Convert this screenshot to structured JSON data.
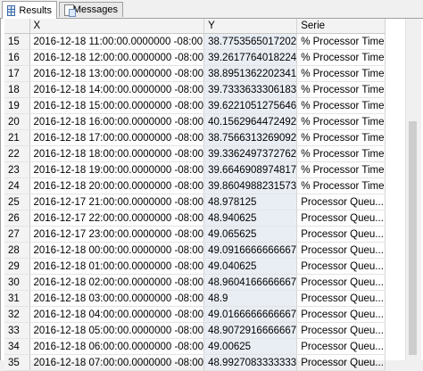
{
  "tabs": [
    {
      "label": "Results",
      "icon": "grid-icon",
      "active": true
    },
    {
      "label": "Messages",
      "icon": "messages-icon",
      "active": false
    }
  ],
  "columns": [
    "",
    "X",
    "Y",
    "Serie"
  ],
  "rows": [
    {
      "n": "15",
      "x": "2016-12-18 11:00:00.0000000 -08:00",
      "y": "38.7753565017202",
      "serie": "% Processor Time"
    },
    {
      "n": "16",
      "x": "2016-12-18 12:00:00.0000000 -08:00",
      "y": "39.2617764018224",
      "serie": "% Processor Time"
    },
    {
      "n": "17",
      "x": "2016-12-18 13:00:00.0000000 -08:00",
      "y": "38.8951362202341",
      "serie": "% Processor Time"
    },
    {
      "n": "18",
      "x": "2016-12-18 14:00:00.0000000 -08:00",
      "y": "39.7333633306183",
      "serie": "% Processor Time"
    },
    {
      "n": "19",
      "x": "2016-12-18 15:00:00.0000000 -08:00",
      "y": "39.6221051275646",
      "serie": "% Processor Time"
    },
    {
      "n": "20",
      "x": "2016-12-18 16:00:00.0000000 -08:00",
      "y": "40.1562964472492",
      "serie": "% Processor Time"
    },
    {
      "n": "21",
      "x": "2016-12-18 17:00:00.0000000 -08:00",
      "y": "38.7566313269092",
      "serie": "% Processor Time"
    },
    {
      "n": "22",
      "x": "2016-12-18 18:00:00.0000000 -08:00",
      "y": "39.3362497372762",
      "serie": "% Processor Time"
    },
    {
      "n": "23",
      "x": "2016-12-18 19:00:00.0000000 -08:00",
      "y": "39.6646908974817",
      "serie": "% Processor Time"
    },
    {
      "n": "24",
      "x": "2016-12-18 20:00:00.0000000 -08:00",
      "y": "39.8604988231573",
      "serie": "% Processor Time"
    },
    {
      "n": "25",
      "x": "2016-12-17 21:00:00.0000000 -08:00",
      "y": "48.978125",
      "serie": "Processor Queu..."
    },
    {
      "n": "26",
      "x": "2016-12-17 22:00:00.0000000 -08:00",
      "y": "48.940625",
      "serie": "Processor Queu..."
    },
    {
      "n": "27",
      "x": "2016-12-17 23:00:00.0000000 -08:00",
      "y": "49.065625",
      "serie": "Processor Queu..."
    },
    {
      "n": "28",
      "x": "2016-12-18 00:00:00.0000000 -08:00",
      "y": "49.0916666666667",
      "serie": "Processor Queu..."
    },
    {
      "n": "29",
      "x": "2016-12-18 01:00:00.0000000 -08:00",
      "y": "49.040625",
      "serie": "Processor Queu..."
    },
    {
      "n": "30",
      "x": "2016-12-18 02:00:00.0000000 -08:00",
      "y": "48.9604166666667",
      "serie": "Processor Queu..."
    },
    {
      "n": "31",
      "x": "2016-12-18 03:00:00.0000000 -08:00",
      "y": "48.9",
      "serie": "Processor Queu..."
    },
    {
      "n": "32",
      "x": "2016-12-18 04:00:00.0000000 -08:00",
      "y": "49.0166666666667",
      "serie": "Processor Queu..."
    },
    {
      "n": "33",
      "x": "2016-12-18 05:00:00.0000000 -08:00",
      "y": "48.9072916666667",
      "serie": "Processor Queu..."
    },
    {
      "n": "34",
      "x": "2016-12-18 06:00:00.0000000 -08:00",
      "y": "49.00625",
      "serie": "Processor Queu..."
    },
    {
      "n": "35",
      "x": "2016-12-18 07:00:00.0000000 -08:00",
      "y": "48.9927083333333",
      "serie": "Processor Queu..."
    }
  ]
}
